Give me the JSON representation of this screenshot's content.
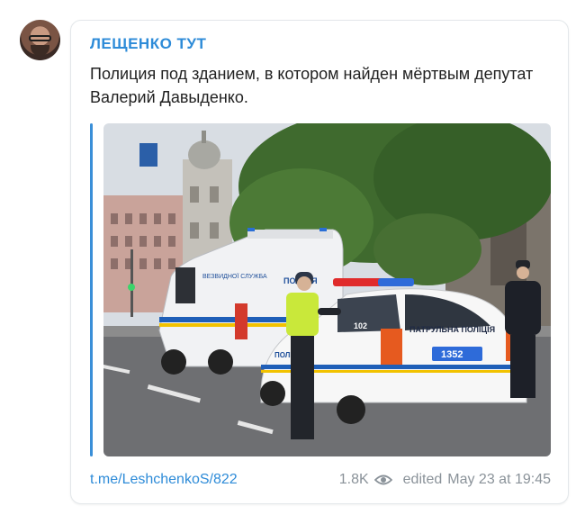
{
  "channel": {
    "name": "ЛЕЩЕНКО ТУТ"
  },
  "message": {
    "text": "Полиция под зданием, в котором найден мёртвым депутат Валерий Давыденко."
  },
  "photo": {
    "van_label": "ПОЛІЦІЯ",
    "van_side_label": "ВЕЗВИДНОЇ СЛУЖБА",
    "car_rear_label": "ПАТРУЛЬНА ПОЛІЦІЯ",
    "car_side_label": "ПОЛІЦІЯ",
    "car_number": "102",
    "plate": "1352"
  },
  "footer": {
    "link": "t.me/LeshchenkoS/822",
    "views": "1.8K",
    "edited": "edited",
    "datetime": "May 23 at 19:45"
  },
  "colors": {
    "accent": "#2d8bd8",
    "quote_bar": "#3a8fd8",
    "meta": "#8a9299"
  },
  "icons": [
    "avatar",
    "eye-icon"
  ]
}
